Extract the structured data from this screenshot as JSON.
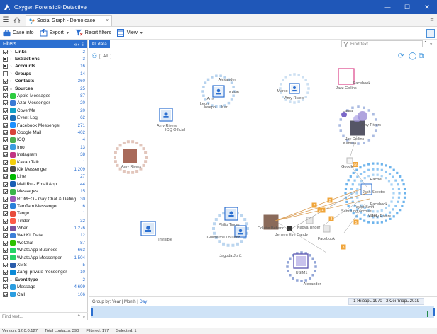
{
  "window": {
    "title": "Oxygen Forensic® Detective",
    "buttons": [
      "—",
      "☐",
      "✕"
    ]
  },
  "tabs": [
    {
      "label": "Social Graph - Demo case",
      "close": "×"
    }
  ],
  "toolbar": {
    "case_info": "Case info",
    "export": "Export",
    "reset_filters": "Reset filters",
    "view": "View"
  },
  "filters": {
    "title": "Filters",
    "header_icons": "«‹ ⁝",
    "categories": [
      {
        "label": "Links",
        "count": "2",
        "check": "checked"
      },
      {
        "label": "Extractions",
        "count": "3",
        "check": "partial"
      },
      {
        "label": "Accounts",
        "count": "16",
        "check": "partial"
      },
      {
        "label": "Groups",
        "count": "14",
        "check": "none"
      },
      {
        "label": "Contacts",
        "count": "360",
        "check": "checked"
      }
    ],
    "sources_header": {
      "label": "Sources",
      "count": "25"
    },
    "sources": [
      {
        "label": "Apple Messages",
        "count": "87",
        "color": "#2ecc40"
      },
      {
        "label": "Azar Messenger",
        "count": "20",
        "color": "#3a7bd5"
      },
      {
        "label": "CoverMe",
        "count": "20",
        "color": "#12a2c7"
      },
      {
        "label": "Event Log",
        "count": "62",
        "color": "#1b6fb8"
      },
      {
        "label": "Facebook Messenger",
        "count": "271",
        "color": "#1e90ff"
      },
      {
        "label": "Google Mail",
        "count": "402",
        "color": "#d8433a"
      },
      {
        "label": "ICQ",
        "count": "4",
        "color": "#4caf50"
      },
      {
        "label": "Imo",
        "count": "13",
        "color": "#3b9de0"
      },
      {
        "label": "Instagram",
        "count": "38",
        "color": "#c13584"
      },
      {
        "label": "Kakao Talk",
        "count": "1",
        "color": "#f5cf0c"
      },
      {
        "label": "Kik Messenger",
        "count": "1 209",
        "color": "#4a4a4a"
      },
      {
        "label": "Line",
        "count": "27",
        "color": "#00b900"
      },
      {
        "label": "Mail.Ru - Email App",
        "count": "44",
        "color": "#1a5fb4"
      },
      {
        "label": "Messages",
        "count": "15",
        "color": "#39b54a"
      },
      {
        "label": "ROMEO - Gay Chat & Dating",
        "count": "30",
        "color": "#9b59b6"
      },
      {
        "label": "TamTam Messenger",
        "count": "6",
        "color": "#2980d9"
      },
      {
        "label": "Tango",
        "count": "1",
        "color": "#e74c3c"
      },
      {
        "label": "Tinder",
        "count": "32",
        "color": "#fe5a47"
      },
      {
        "label": "Viber",
        "count": "1 276",
        "color": "#7b519d"
      },
      {
        "label": "WebKit Data",
        "count": "12",
        "color": "#3c7fd8"
      },
      {
        "label": "WeChat",
        "count": "87",
        "color": "#2dc100"
      },
      {
        "label": "WhatsApp Business",
        "count": "663",
        "color": "#25d366"
      },
      {
        "label": "WhatsApp Messenger",
        "count": "1 504",
        "color": "#25d366"
      },
      {
        "label": "XMS",
        "count": "5",
        "color": "#2a5caa"
      },
      {
        "label": "Zangi private messenger",
        "count": "10",
        "color": "#0c8ad6"
      }
    ],
    "event_type_header": {
      "label": "Event type",
      "count": "2"
    },
    "event_types": [
      {
        "label": "Message",
        "count": "4 699",
        "color": "#2b9de0"
      },
      {
        "label": "Call",
        "count": "106",
        "color": "#2b9de0"
      }
    ],
    "find_placeholder": "Find text...",
    "find_nav": "⌃ ⌄"
  },
  "graph": {
    "tab_label": "All data",
    "find_placeholder": "Find text...",
    "find_nav": "⌃ ⌄",
    "all_pill": "All",
    "labels": [
      "Alexander",
      "Kevin",
      "Amy",
      "Leon",
      "Joseph",
      "Karl",
      "Amy Rivers",
      "ICQ Official",
      "Marco",
      "Amy Rivers",
      "Jazz Collins",
      "Facebook",
      "Laura",
      "Amy Rivers",
      "Jay Collins",
      "Kamilla",
      "Nadya Tinder",
      "Jensen Eye Candy",
      "Colette Behand",
      "Guilherme Lourenz",
      "Jagoda Jurić",
      "Invisible",
      "Facebook",
      "Josh Spector",
      "Google",
      "Tayler Swift",
      "Samsung account",
      "Viber",
      "Facebook",
      "Rachel",
      "Amy Rivers",
      "Amy Rivers",
      "USIM1",
      "Alexander",
      "Philip Tinder",
      "Marcella Schenko",
      "Alice Fogagnolo",
      "Tim Cook",
      "Theresa",
      "Betina",
      "Mike",
      "Mark"
    ],
    "edge_badges": [
      "7",
      "2",
      "3",
      "4",
      "2",
      "5",
      "3"
    ],
    "google_badge": "96"
  },
  "timeline": {
    "group_by_label": "Group by:",
    "year": "Year",
    "month": "Month",
    "day": "Day",
    "range": "1 Январь 1970 - 2 Сентябрь 2019"
  },
  "status": {
    "version": "Version: 12.0.0.127",
    "total": "Total contacts: 390",
    "filtered": "Filtered: 177",
    "selected": "Selected: 1"
  }
}
